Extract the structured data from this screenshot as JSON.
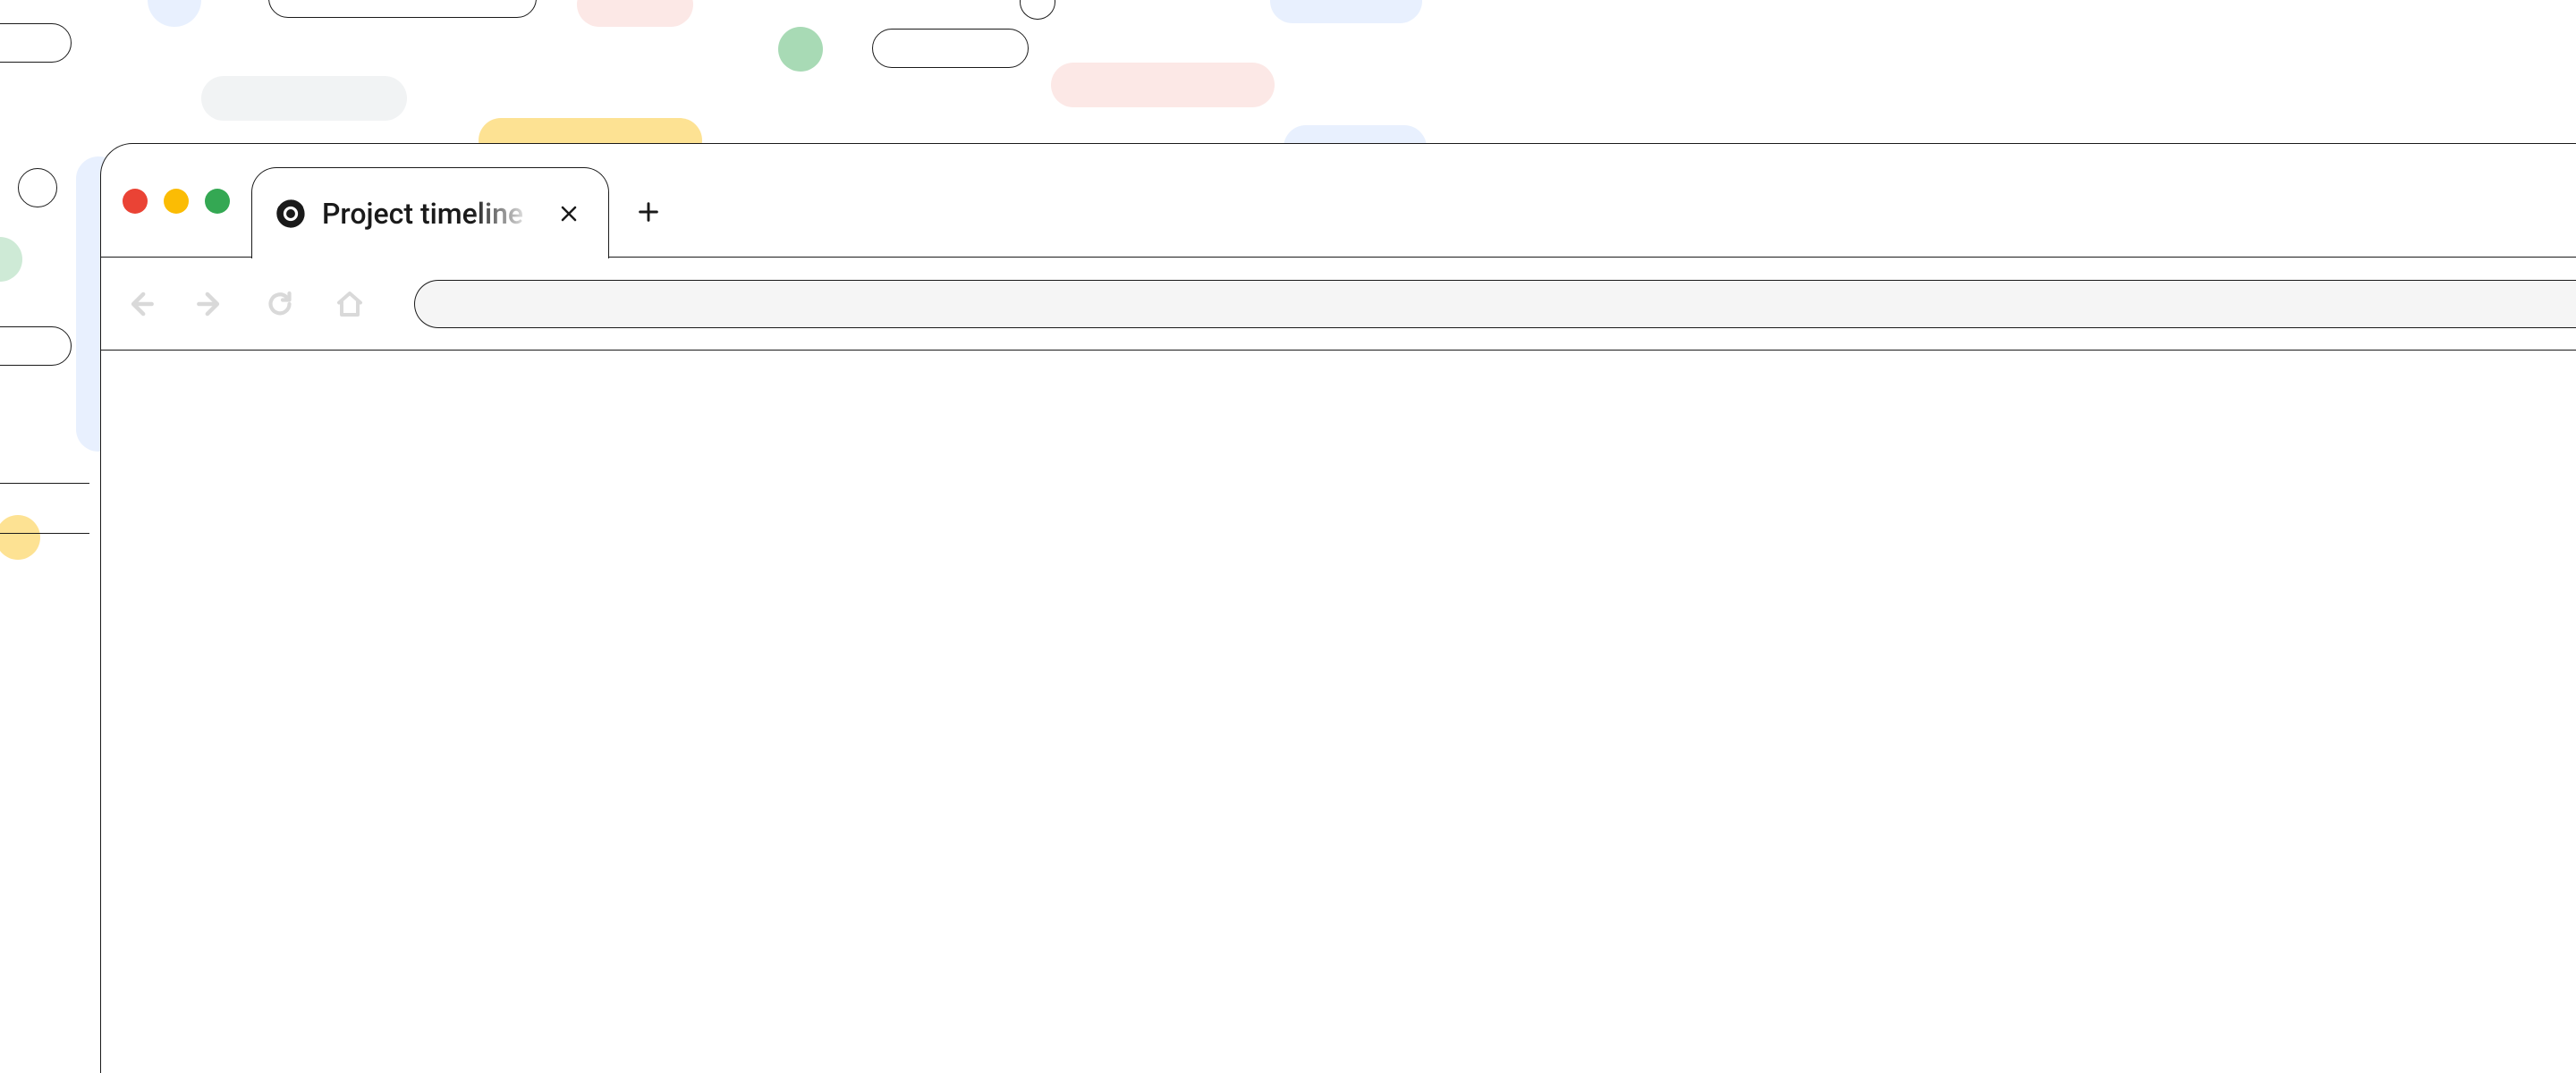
{
  "window": {
    "traffic_lights": {
      "close_color": "#ea4335",
      "minimize_color": "#fbbc04",
      "zoom_color": "#34a853"
    }
  },
  "tabs": [
    {
      "title": "Project timeline",
      "favicon": "chrome-icon"
    }
  ],
  "toolbar": {
    "back_icon": "arrow-left-icon",
    "forward_icon": "arrow-right-icon",
    "reload_icon": "reload-icon",
    "home_icon": "home-icon",
    "address_value": "",
    "address_placeholder": ""
  },
  "decor": {
    "colors": {
      "blue": "#e8f0fe",
      "gray": "#f1f3f4",
      "red": "#fce8e6",
      "yellow": "#feefc3",
      "green": "#ceead6",
      "yellow_solid": "#fde293",
      "green_solid": "#a8dab5"
    }
  }
}
